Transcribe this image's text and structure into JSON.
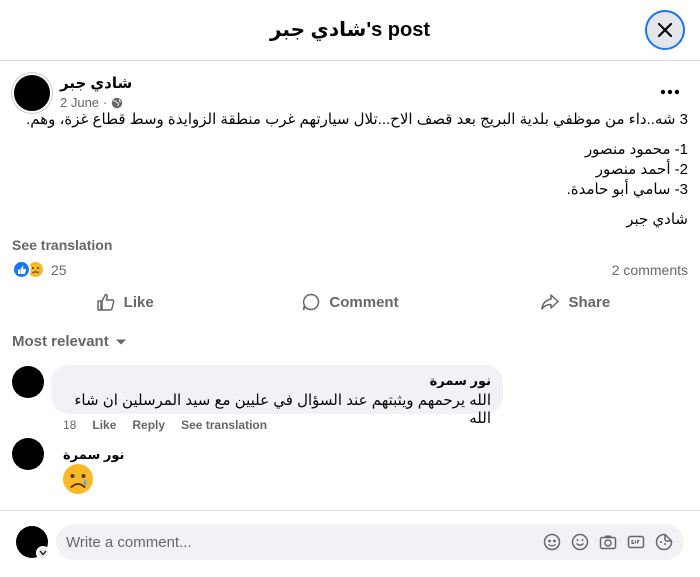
{
  "header": {
    "title": "شادي جبر's post"
  },
  "post": {
    "author": "شادي جبر",
    "date": "2 June",
    "date_sep": "·",
    "lines": [
      "3 شه..داء من موظفي بلدية البريج بعد قصف الاح...تلال سيارتهم غرب منطقة الزوايدة وسط قطاع غزة، وهم.",
      "1- محمود منصور",
      "2- أحمد منصور",
      "3- سامي أبو حامدة.",
      "شادي جبر"
    ],
    "see_translation": "See translation",
    "reaction_count": "25",
    "comments_count": "2 comments"
  },
  "actions": {
    "like": "Like",
    "comment": "Comment",
    "share": "Share"
  },
  "sort": {
    "label": "Most relevant"
  },
  "comments": [
    {
      "author": "نور سمرة",
      "text": "الله يرحمهم ويثبتهم عند السؤال في عليين مع سيد المرسلين ان شاء الله",
      "time": "18",
      "like": "Like",
      "reply": "Reply",
      "see_translation": "See translation"
    },
    {
      "author": "نور سمرة"
    }
  ],
  "composer": {
    "placeholder": "Write a comment..."
  },
  "colors": {
    "accent": "#1877f2",
    "bubble": "#f0f2f5",
    "secondary_text": "#65676b"
  },
  "icons": [
    "close-icon",
    "globe-icon",
    "more-icon",
    "like-reaction-icon",
    "sad-reaction-icon",
    "thumbs-up-icon",
    "comment-icon",
    "share-icon",
    "chevron-down-icon",
    "avatar-sticker-icon",
    "emoji-icon",
    "camera-icon",
    "gif-icon",
    "sticker-icon"
  ]
}
